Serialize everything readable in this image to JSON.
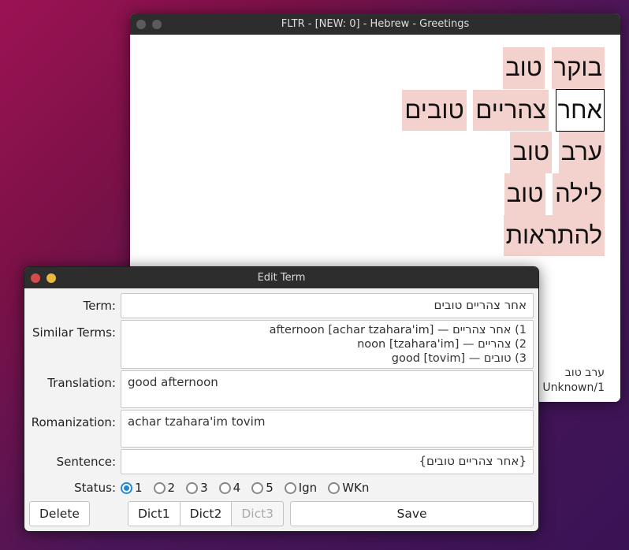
{
  "reader": {
    "title": "FLTR - [NEW: 0] - Hebrew - Greetings",
    "lines": [
      {
        "words": [
          {
            "text": "בוקר",
            "highlight": true,
            "selected": false
          },
          {
            "text": "טוב",
            "highlight": true,
            "selected": false
          }
        ]
      },
      {
        "words": [
          {
            "text": "אחר",
            "highlight": false,
            "selected": true
          },
          {
            "text": "צהריים",
            "highlight": true,
            "selected": false
          },
          {
            "text": "טובים",
            "highlight": true,
            "selected": false
          }
        ]
      },
      {
        "words": [
          {
            "text": "ערב",
            "highlight": true,
            "selected": false
          },
          {
            "text": "טוב",
            "highlight": true,
            "selected": false
          }
        ]
      },
      {
        "words": [
          {
            "text": "לילה",
            "highlight": true,
            "selected": false
          },
          {
            "text": "טוב",
            "highlight": true,
            "selected": false
          }
        ]
      },
      {
        "words": [
          {
            "text": "להתראות",
            "highlight": true,
            "selected": false
          }
        ]
      }
    ],
    "status_phrase": "ערב טוב",
    "status_detail": "- Unknown/1"
  },
  "edit": {
    "title": "Edit Term",
    "labels": {
      "term": "Term:",
      "similar": "Similar Terms:",
      "translation": "Translation:",
      "romanization": "Romanization:",
      "sentence": "Sentence:",
      "status": "Status:"
    },
    "term_value": "אחר צהריים טובים",
    "similar_terms": [
      "1) אחר צהריים — afternoon [achar tzahara'im]",
      "2) צהריים — noon [tzahara'im]",
      "3) טובים — good [tovim]"
    ],
    "translation_value": "good afternoon",
    "romanization_value": "achar tzahara'im tovim",
    "sentence_value": "{אחר צהריים טובים}",
    "status_options": [
      "1",
      "2",
      "3",
      "4",
      "5",
      "Ign",
      "WKn"
    ],
    "status_selected": "1",
    "buttons": {
      "delete": "Delete",
      "dict1": "Dict1",
      "dict2": "Dict2",
      "dict3": "Dict3",
      "save": "Save"
    }
  }
}
